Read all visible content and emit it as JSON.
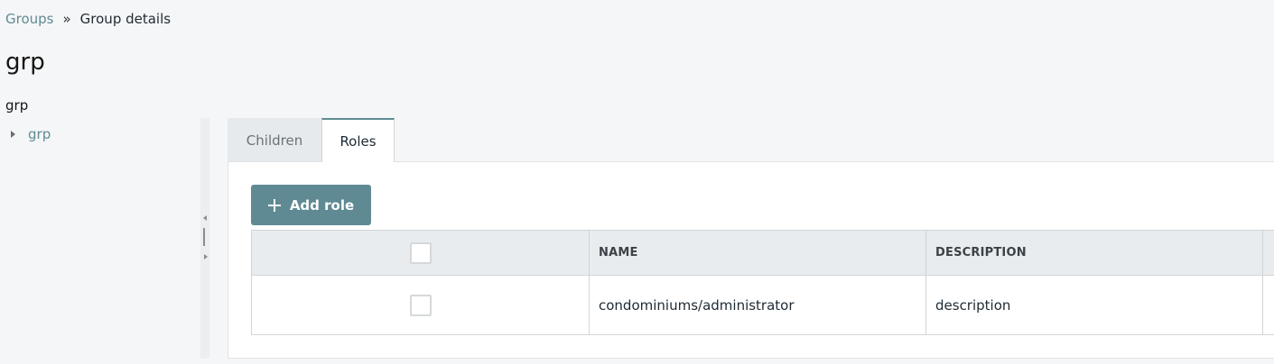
{
  "breadcrumb": {
    "parent": "Groups",
    "separator": "»",
    "current": "Group details"
  },
  "page": {
    "title": "grp"
  },
  "tree": {
    "root_label": "grp",
    "nodes": [
      {
        "label": "grp",
        "expanded": false
      }
    ]
  },
  "tabs": [
    {
      "label": "Children",
      "active": false
    },
    {
      "label": "Roles",
      "active": true
    }
  ],
  "roles": {
    "add_button_label": "Add role",
    "columns": [
      "NAME",
      "DESCRIPTION"
    ],
    "rows": [
      {
        "checked": false,
        "name": "condominiums/administrator",
        "description": "description"
      }
    ]
  },
  "colors": {
    "accent": "#5f8a93",
    "header_bg": "#e9ecee",
    "page_bg": "#f5f6f7"
  }
}
